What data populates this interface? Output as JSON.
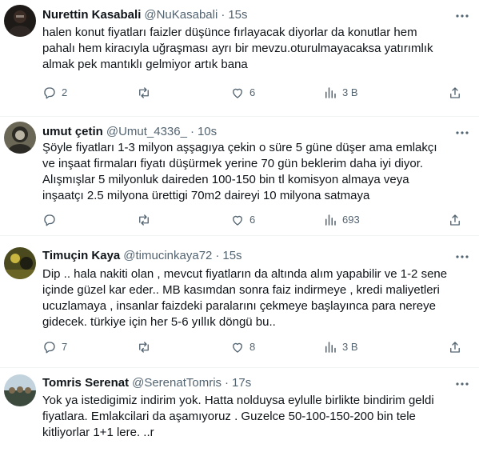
{
  "tweets": [
    {
      "name": "Nurettin Kasabali",
      "handle": "@NuKasabali",
      "separator": "·",
      "time": "15s",
      "text": "halen konut fiyatları faizler düşünce fırlayacak diyorlar da konutlar hem\npahalı hem kiracıyla uğraşması ayrı bir mevzu.oturulmayacaksa yatırımlık\nalmak pek mantıklı gelmiyor artık bana",
      "replies": "2",
      "retweets": "",
      "likes": "6",
      "views": "3 B",
      "avatar_colors": [
        "#3a2c24",
        "#1d1a18",
        "#d9cfc4"
      ]
    },
    {
      "name": "umut çetin",
      "handle": "@Umut_4336_",
      "separator": "·",
      "time": "10s",
      "text": "Şöyle fiyatları 1-3  milyon aşşagıya çekin o süre 5 güne düşer ama emlakçı\nve inşaat firmaları fiyatı düşürmek yerine 70 gün beklerim daha iyi diyor.\nAlışmışlar 5 milyonluk daireden 100-150 bin tl komisyon almaya veya\ninşaatçı 2.5 milyona ürettigi 70m2 daireyi 10 milyona satmaya",
      "replies": "",
      "retweets": "",
      "likes": "6",
      "views": "693",
      "avatar_colors": [
        "#6b6756",
        "#2b2a24",
        "#b8b3a3"
      ]
    },
    {
      "name": "Timuçin Kaya",
      "handle": "@timucinkaya72",
      "separator": "·",
      "time": "15s",
      "text": "Dip .. hala nakiti olan , mevcut fiyatların da altında alım yapabilir ve 1-2 sene\niçinde güzel kar eder.. MB kasımdan sonra faiz indirmeye , kredi maliyetleri\nucuzlamaya , insanlar faizdeki paralarını çekmeye başlayınca para nereye\ngidecek. türkiye için her 5-6 yıllık döngü bu..",
      "replies": "7",
      "retweets": "",
      "likes": "8",
      "views": "3 B",
      "avatar_colors": [
        "#4a4a1e",
        "#c9b640",
        "#1e1e12"
      ]
    },
    {
      "name": "Tomris Serenat",
      "handle": "@SerenatTomris",
      "separator": "·",
      "time": "17s",
      "text": "Yok ya istedigimiz indirim yok. Hatta nolduysa eylulle birlikte bindirim geldi\nfiyatlara. Emlakcilari da aşamıyoruz . Guzelce 50-100-150-200 bin tele\nkitliyorlar 1+1 lere. ..r",
      "replies": "",
      "retweets": "",
      "likes": "",
      "views": "",
      "avatar_colors": [
        "#c2d3de",
        "#3c4a3e",
        "#7b6a4f"
      ]
    }
  ],
  "colors": {
    "text_primary": "#0f1419",
    "text_secondary": "#536471",
    "divider": "#eff3f4",
    "background": "#ffffff"
  },
  "icons": {
    "reply": "reply-icon",
    "retweet": "retweet-icon",
    "like": "heart-icon",
    "views": "views-icon",
    "share": "share-icon",
    "more": "more-icon"
  }
}
